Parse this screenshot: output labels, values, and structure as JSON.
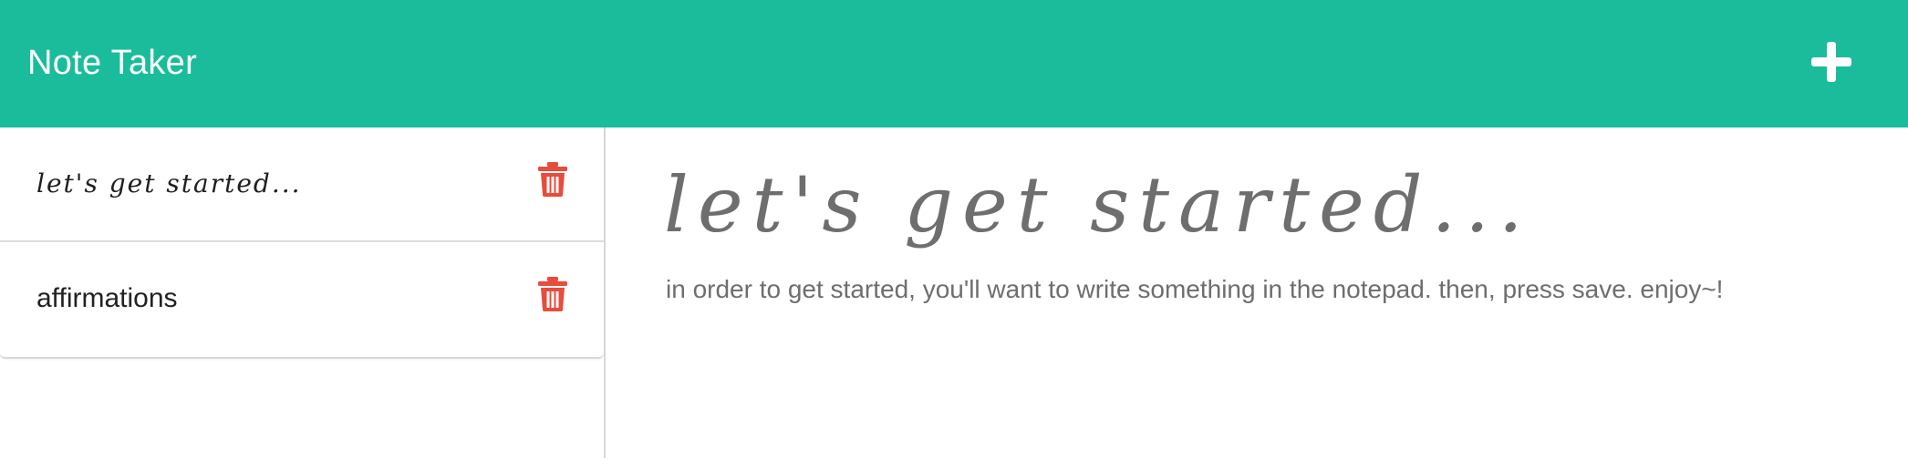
{
  "app": {
    "title": "Note Taker",
    "accent_color": "#1abc9c",
    "add_icon": "plus-icon"
  },
  "sidebar": {
    "notes": [
      {
        "title": "let's get started...",
        "delete_icon": "trash-icon"
      },
      {
        "title": "affirmations",
        "delete_icon": "trash-icon"
      }
    ],
    "delete_color": "#e74c3c"
  },
  "editor": {
    "title": "let's get started...",
    "text": "in order to get started, you'll want to write something in the notepad. then, press save. enjoy~!"
  }
}
